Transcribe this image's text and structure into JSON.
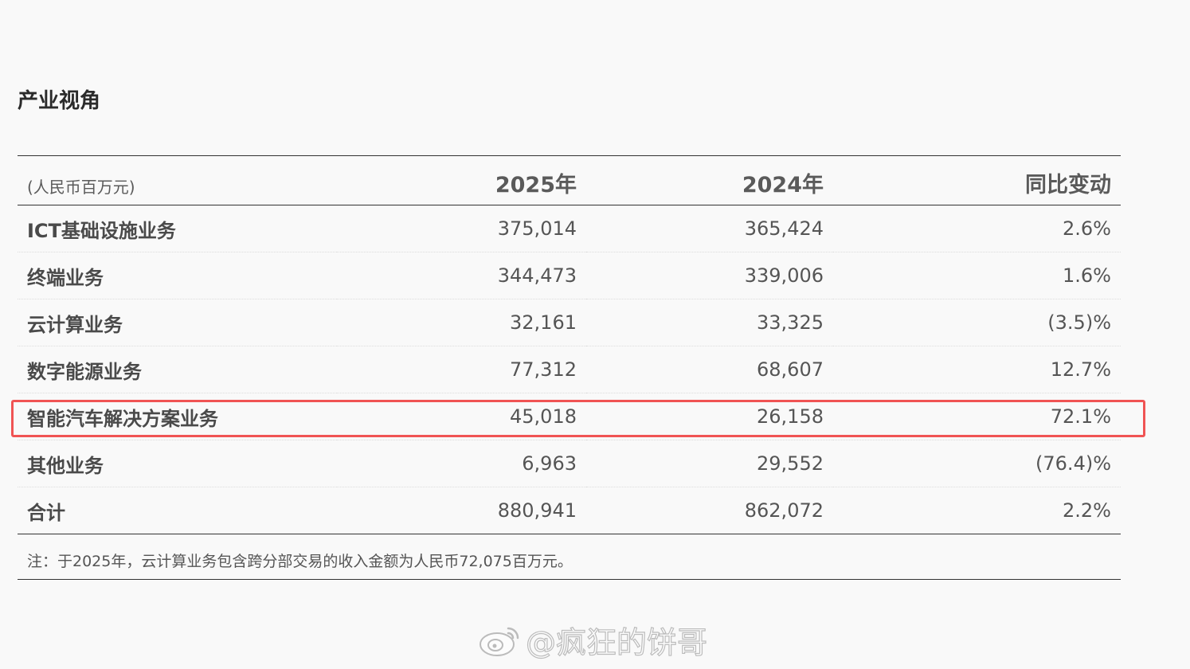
{
  "section": {
    "title": "产业视角"
  },
  "table": {
    "columns": [
      "(人民币百万元)",
      "2025年",
      "2024年",
      "同比变动"
    ],
    "rows": [
      [
        "ICT基础设施业务",
        "375,014",
        "365,424",
        "2.6%"
      ],
      [
        "终端业务",
        "344,473",
        "339,006",
        "1.6%"
      ],
      [
        "云计算业务",
        "32,161",
        "33,325",
        "(3.5)%"
      ],
      [
        "数字能源业务",
        "77,312",
        "68,607",
        "12.7%"
      ],
      [
        "智能汽车解决方案业务",
        "45,018",
        "26,158",
        "72.1%"
      ],
      [
        "其他业务",
        "6,963",
        "29,552",
        "(76.4)%"
      ],
      [
        "合计",
        "880,941",
        "862,072",
        "2.2%"
      ]
    ],
    "highlighted_row": 4
  },
  "note": "注：于2025年，云计算业务包含跨分部交易的收入金额为人民币72,075百万元。",
  "watermark": {
    "text": "@疯狂的饼哥",
    "icon": "weibo-logo-icon"
  },
  "colors": {
    "highlight": "#f05454",
    "rule": "#333333",
    "background": "#f9f9f9"
  }
}
